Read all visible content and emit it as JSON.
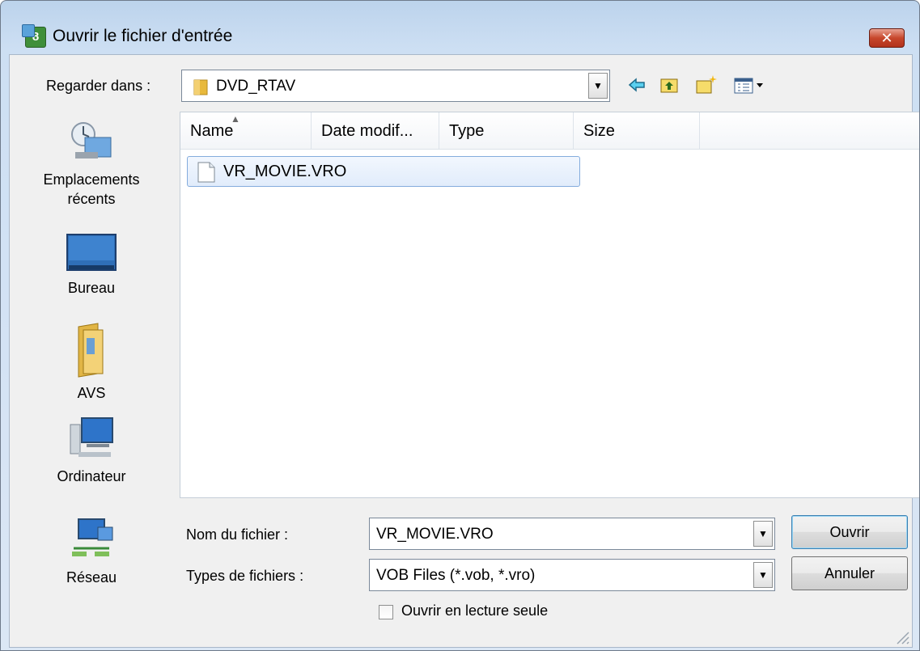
{
  "window": {
    "title": "Ouvrir le fichier d'entrée",
    "close_label": "✕"
  },
  "look_in": {
    "label": "Regarder dans :",
    "value": "DVD_RTAV"
  },
  "toolbar": {
    "back_icon": "back-arrow-icon",
    "up_icon": "up-folder-icon",
    "new_folder_icon": "new-folder-icon",
    "view_menu_icon": "view-menu-icon"
  },
  "places": [
    {
      "label_line1": "Emplacements",
      "label_line2": "récents",
      "icon": "recent-places-icon"
    },
    {
      "label_line1": "Bureau",
      "label_line2": "",
      "icon": "desktop-icon"
    },
    {
      "label_line1": "AVS",
      "label_line2": "",
      "icon": "library-folder-icon"
    },
    {
      "label_line1": "Ordinateur",
      "label_line2": "",
      "icon": "computer-icon"
    },
    {
      "label_line1": "Réseau",
      "label_line2": "",
      "icon": "network-icon"
    }
  ],
  "file_list": {
    "columns": [
      "Name",
      "Date modif...",
      "Type",
      "Size"
    ],
    "files": [
      {
        "name": "VR_MOVIE.VRO",
        "selected": true
      }
    ]
  },
  "file_name": {
    "label": "Nom du fichier :",
    "value": "VR_MOVIE.VRO"
  },
  "file_type": {
    "label": "Types de fichiers :",
    "value": "VOB Files (*.vob, *.vro)"
  },
  "buttons": {
    "open": "Ouvrir",
    "cancel": "Annuler"
  },
  "read_only": {
    "label": "Ouvrir en lecture seule",
    "checked": false
  },
  "colors": {
    "title_bar": "#cddff3",
    "close_button": "#c7472c",
    "selection": "#e1ecfb"
  }
}
